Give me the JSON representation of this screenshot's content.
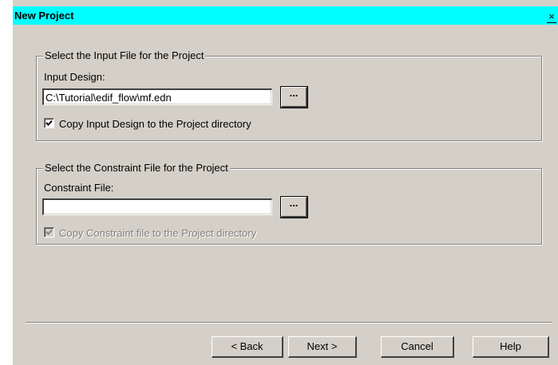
{
  "window": {
    "title": "New Project",
    "close_glyph": "×"
  },
  "input_group": {
    "legend": "Select the Input File for the Project",
    "field_label": "Input Design:",
    "field_value": "C:\\Tutorial\\edif_flow\\mf.edn",
    "browse_label": "...",
    "checkbox_checked": true,
    "checkbox_label": "Copy Input Design to the Project directory"
  },
  "constraint_group": {
    "legend": "Select the Constraint File for the Project",
    "field_label": "Constraint File:",
    "field_value": "",
    "browse_label": "...",
    "checkbox_checked": true,
    "checkbox_disabled": true,
    "checkbox_label": "Copy Constraint file to the Project directory"
  },
  "buttons": {
    "back": "< Back",
    "next": "Next >",
    "cancel": "Cancel",
    "help": "Help"
  },
  "colors": {
    "titlebar": "#00ffff",
    "dialog_bg": "#d4d0c8",
    "disabled_text": "#808080"
  }
}
